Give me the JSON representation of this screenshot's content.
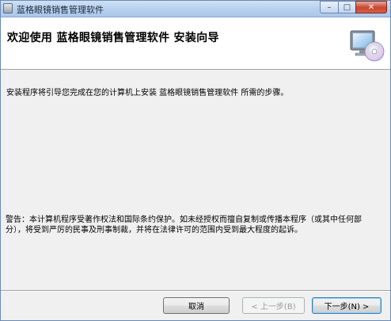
{
  "window": {
    "title": "蓝格眼镜销售管理软件",
    "minimize_glyph": "–",
    "maximize_glyph": "□",
    "close_glyph": "✕"
  },
  "header": {
    "title": "欢迎使用  蓝格眼镜销售管理软件  安装向导",
    "graphic_icon": "computer-cd-icon"
  },
  "content": {
    "intro": "安装程序将引导您完成在您的计算机上安装 蓝格眼镜销售管理软件 所需的步骤。",
    "warning": "警告：本计算机程序受著作权法和国际条约保护。如未经授权而擅自复制或传播本程序（或其中任何部分），将受到严厉的民事及刑事制裁，并将在法律许可的范围内受到最大程度的起诉。"
  },
  "buttons": {
    "cancel": "取消",
    "back": "< 上一步(B)",
    "next": "下一步(N) >"
  },
  "colors": {
    "titlebar": "#b9d1ee",
    "header_bg": "#ffffff",
    "body_bg": "#f0f0f0",
    "close_red": "#c9452f"
  }
}
